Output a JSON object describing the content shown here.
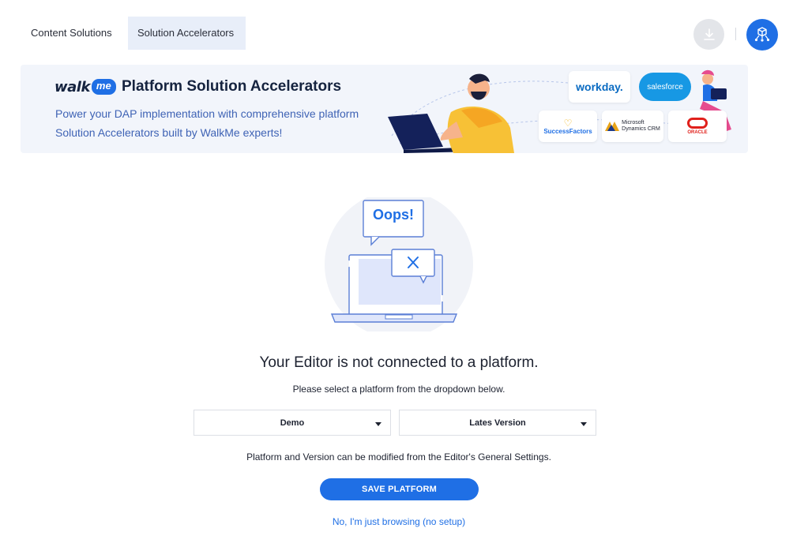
{
  "tabs": [
    {
      "label": "Content Solutions",
      "active": false
    },
    {
      "label": "Solution Accelerators",
      "active": true
    }
  ],
  "header_actions": {
    "download_icon": "download-icon",
    "package_icon": "package-network-icon"
  },
  "banner": {
    "logo_walk": "walk",
    "logo_me": "me",
    "title": "Platform Solution Accelerators",
    "subtitle": "Power your DAP implementation with comprehensive platform Solution Accelerators built by WalkMe experts!",
    "platform_logos": {
      "workday": "workday.",
      "salesforce": "salesforce",
      "successfactors": "SuccessFactors",
      "dynamics_line1": "Microsoft",
      "dynamics_line2": "Dynamics",
      "dynamics_line3": "CRM",
      "oracle": "ORACLE"
    }
  },
  "illustration": {
    "bubble_text": "Oops!"
  },
  "main": {
    "headline": "Your Editor is not connected to a platform.",
    "subline": "Please select a platform from the dropdown below.",
    "platform_select": {
      "value": "Demo"
    },
    "version_select": {
      "value": "Lates Version"
    },
    "note": "Platform and Version can be modified from the Editor's General Settings.",
    "save_button": "SAVE PLATFORM",
    "browse_link": "No, I'm just browsing (no setup)"
  },
  "colors": {
    "accent": "#1f6fe5",
    "banner_bg": "#f2f5fb",
    "banner_title": "#15233f",
    "banner_sub": "#3f63b5"
  }
}
